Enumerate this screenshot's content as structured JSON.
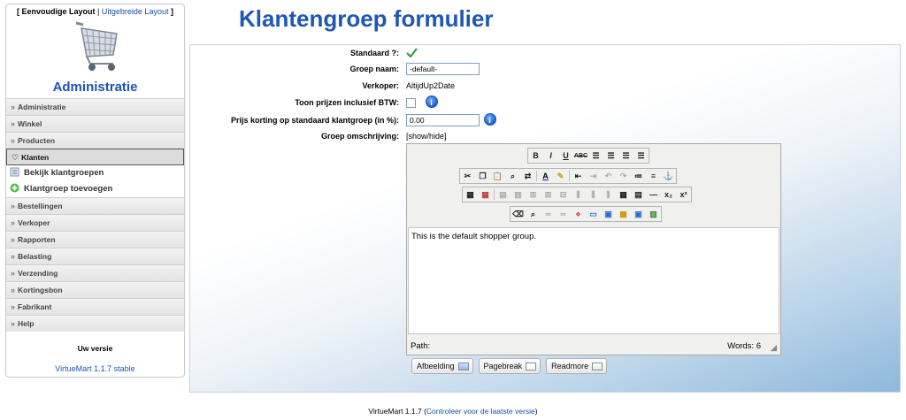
{
  "sidebar": {
    "layout_simple": "Eenvoudige Layout",
    "layout_separator": "|",
    "layout_extended": "Uitgebreide Layout",
    "bracket_open": "[",
    "bracket_close": "]",
    "logo_icon": "shopping-cart-icon",
    "title": "Administratie",
    "menu": [
      {
        "label": "Administratie",
        "open": false
      },
      {
        "label": "Winkel",
        "open": false
      },
      {
        "label": "Producten",
        "open": false
      },
      {
        "label": "Klanten",
        "open": true
      },
      {
        "label": "Bestellingen",
        "open": false
      },
      {
        "label": "Verkoper",
        "open": false
      },
      {
        "label": "Rapporten",
        "open": false
      },
      {
        "label": "Belasting",
        "open": false
      },
      {
        "label": "Verzending",
        "open": false
      },
      {
        "label": "Kortingsbon",
        "open": false
      },
      {
        "label": "Fabrikant",
        "open": false
      },
      {
        "label": "Help",
        "open": false
      }
    ],
    "submenu": [
      {
        "label": "Bekijk klantgroepen",
        "icon": "list-icon"
      },
      {
        "label": "Klantgroep toevoegen",
        "icon": "add-icon"
      }
    ],
    "version_label": "Uw versie",
    "version_link": "VirtueMart 1.1.7 stable"
  },
  "page": {
    "title": "Klantengroep formulier"
  },
  "form": {
    "default_label": "Standaard ?:",
    "default_icon": "checkmark-icon",
    "group_name_label": "Groep naam:",
    "group_name_value": "-default-",
    "vendor_label": "Verkoper:",
    "vendor_value": "AltijdUp2Date",
    "show_prices_label": "Toon prijzen inclusief BTW:",
    "show_prices_checked": false,
    "discount_label": "Prijs korting op standaard klantgroep (in %):",
    "discount_value": "0.00",
    "description_label": "Groep omschrijving:",
    "show_hide": "[show/hide]",
    "info_glyph": "i"
  },
  "editor": {
    "content": "This is the default shopper group.",
    "path_label": "Path:",
    "words_label": "Words: 6",
    "toolbar_row1": [
      "B",
      "I",
      "U",
      "ABC"
    ],
    "buttons": [
      {
        "label": "Afbeelding",
        "icon": "image-icon"
      },
      {
        "label": "Pagebreak",
        "icon": "pagebreak-icon"
      },
      {
        "label": "Readmore",
        "icon": "readmore-icon"
      }
    ]
  },
  "footer": {
    "text": "VirtueMart 1.1.7",
    "link": "Controleer voor de laatste versie",
    "paren_open": "(",
    "paren_close": ")"
  },
  "colors": {
    "accent": "#1f57b5",
    "link": "#1a4fa8",
    "panel_gradient_end": "#8fb8dc"
  }
}
